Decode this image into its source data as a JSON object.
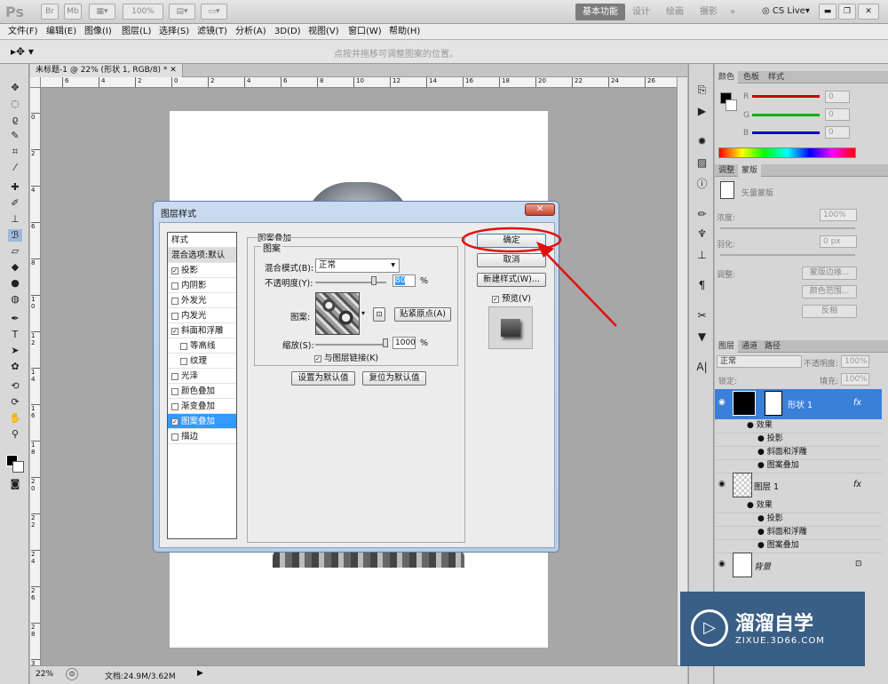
{
  "app": {
    "logo": "Ps",
    "zoom_combo": "100%",
    "workspaces": [
      "基本功能",
      "设计",
      "绘画",
      "摄影"
    ],
    "more": "»",
    "cslive": "CS Live"
  },
  "menu": [
    "文件(F)",
    "编辑(E)",
    "图像(I)",
    "图层(L)",
    "选择(S)",
    "滤镜(T)",
    "分析(A)",
    "3D(D)",
    "视图(V)",
    "窗口(W)",
    "帮助(H)"
  ],
  "options_hint": "点按并拖移可调整图案的位置。",
  "document": {
    "tab_title": "未标题-1 @ 22% (形状 1, RGB/8) *",
    "ruler_ticks": [
      "6",
      "4",
      "2",
      "0",
      "2",
      "4",
      "6",
      "8",
      "10",
      "12",
      "14",
      "16",
      "18",
      "20",
      "22",
      "24",
      "26"
    ],
    "vruler_ticks": [
      "0",
      "2",
      "4",
      "6",
      "8",
      "1 0",
      "1 2",
      "1 4",
      "1 6",
      "1 8",
      "2 0",
      "2 2",
      "2 4",
      "2 6",
      "2 8",
      "3"
    ]
  },
  "status": {
    "zoom": "22%",
    "doc_info": "文档:24.9M/3.62M"
  },
  "dialog": {
    "title": "图层样式",
    "styles_header": "样式",
    "blend_default": "混合选项:默认",
    "items": [
      {
        "label": "投影",
        "checked": true,
        "indent": false,
        "selected": false
      },
      {
        "label": "内阴影",
        "checked": false,
        "indent": false,
        "selected": false
      },
      {
        "label": "外发光",
        "checked": false,
        "indent": false,
        "selected": false
      },
      {
        "label": "内发光",
        "checked": false,
        "indent": false,
        "selected": false
      },
      {
        "label": "斜面和浮雕",
        "checked": true,
        "indent": false,
        "selected": false
      },
      {
        "label": "等高线",
        "checked": false,
        "indent": true,
        "selected": false
      },
      {
        "label": "纹理",
        "checked": false,
        "indent": true,
        "selected": false
      },
      {
        "label": "光泽",
        "checked": false,
        "indent": false,
        "selected": false
      },
      {
        "label": "颜色叠加",
        "checked": false,
        "indent": false,
        "selected": false
      },
      {
        "label": "渐变叠加",
        "checked": false,
        "indent": false,
        "selected": false
      },
      {
        "label": "图案叠加",
        "checked": true,
        "indent": false,
        "selected": true
      },
      {
        "label": "描边",
        "checked": false,
        "indent": false,
        "selected": false
      }
    ],
    "section_title": "图案叠加",
    "group_title": "图案",
    "blend_mode_label": "混合模式(B):",
    "blend_mode_value": "正常",
    "opacity_label": "不透明度(Y):",
    "opacity_value": "80",
    "opacity_fraction": 0.8,
    "percent": "%",
    "pattern_label": "图案:",
    "snap_origin": "贴紧原点(A)",
    "scale_label": "缩放(S):",
    "scale_value": "1000",
    "link_label": "与图层链接(K)",
    "make_default": "设置为默认值",
    "reset_default": "复位为默认值",
    "ok": "确定",
    "cancel": "取消",
    "new_style": "新建样式(W)...",
    "preview": "预览(V)"
  },
  "color_panel": {
    "tabs": [
      "颜色",
      "色板",
      "样式"
    ],
    "channels": [
      {
        "label": "R",
        "value": "0",
        "color": "#d00000"
      },
      {
        "label": "G",
        "value": "0",
        "color": "#00b000"
      },
      {
        "label": "B",
        "value": "0",
        "color": "#0000cc"
      }
    ]
  },
  "adjust_panel": {
    "tabs": [
      "调整",
      "蒙版"
    ],
    "mask_text": "矢量蒙版",
    "density_label": "浓度:",
    "density_value": "100%",
    "feather_label": "羽化:",
    "feather_value": "0 px",
    "refine_label": "调整:",
    "buttons": [
      "蒙版边缘...",
      "颜色范围...",
      "反相"
    ]
  },
  "layers_panel": {
    "tabs": [
      "图层",
      "通道",
      "路径"
    ],
    "blend": "正常",
    "opacity_label": "不透明度:",
    "opacity_value": "100%",
    "lock_label": "锁定:",
    "fill_label": "填充:",
    "fill_value": "100%",
    "layers": [
      {
        "name": "形状 1",
        "fx": "fx",
        "effects_label": "效果",
        "effects": [
          "投影",
          "斜面和浮雕",
          "图案叠加"
        ]
      },
      {
        "name": "图层 1",
        "fx": "fx",
        "effects_label": "效果",
        "effects": [
          "投影",
          "斜面和浮雕",
          "图案叠加"
        ]
      }
    ],
    "background": "背景"
  },
  "watermark": {
    "brand": "溜溜自学",
    "url": "ZIXUE.3D66.COM"
  }
}
